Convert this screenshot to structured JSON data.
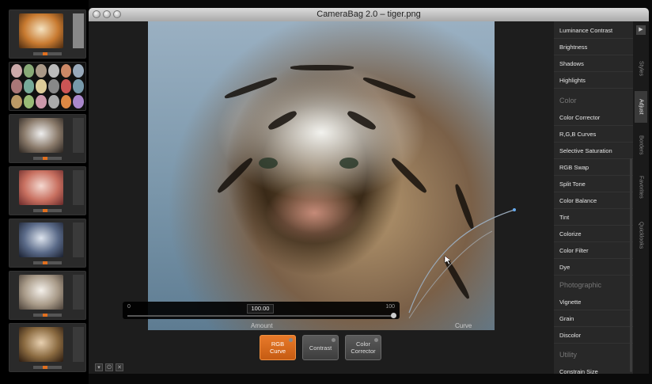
{
  "window": {
    "title": "CameraBag 2.0 – tiger.png"
  },
  "amount": {
    "min": "0",
    "max": "100",
    "value": "100.00",
    "label": "Amount"
  },
  "curve_label": "Curve",
  "effects": [
    {
      "label": "RGB\nCurve",
      "active": true
    },
    {
      "label": "Contrast",
      "active": false
    },
    {
      "label": "Color\nCorrector",
      "active": false
    }
  ],
  "bottom_icons": [
    "▾",
    "⏻",
    "✕"
  ],
  "panel": {
    "top_items": [
      "Luminance Contrast",
      "Brightness",
      "Shadows",
      "Highlights"
    ],
    "sections": [
      {
        "header": "Color",
        "items": [
          "Color Corrector",
          "R,G,B Curves",
          "Selective Saturation",
          "RGB Swap",
          "Split Tone",
          "Color Balance",
          "Tint",
          "Colorize",
          "Color Filter",
          "Dye"
        ]
      },
      {
        "header": "Photographic",
        "items": [
          "Vignette",
          "Grain",
          "Discolor"
        ]
      },
      {
        "header": "Utility",
        "items": [
          "Constrain Size"
        ]
      }
    ]
  },
  "side_tabs": [
    "Styles",
    "Adjust",
    "Borders",
    "Favorites",
    "Quicklooks"
  ],
  "side_tab_active": "Adjust",
  "colors": {
    "accent": "#e07020",
    "panel": "#282828"
  }
}
